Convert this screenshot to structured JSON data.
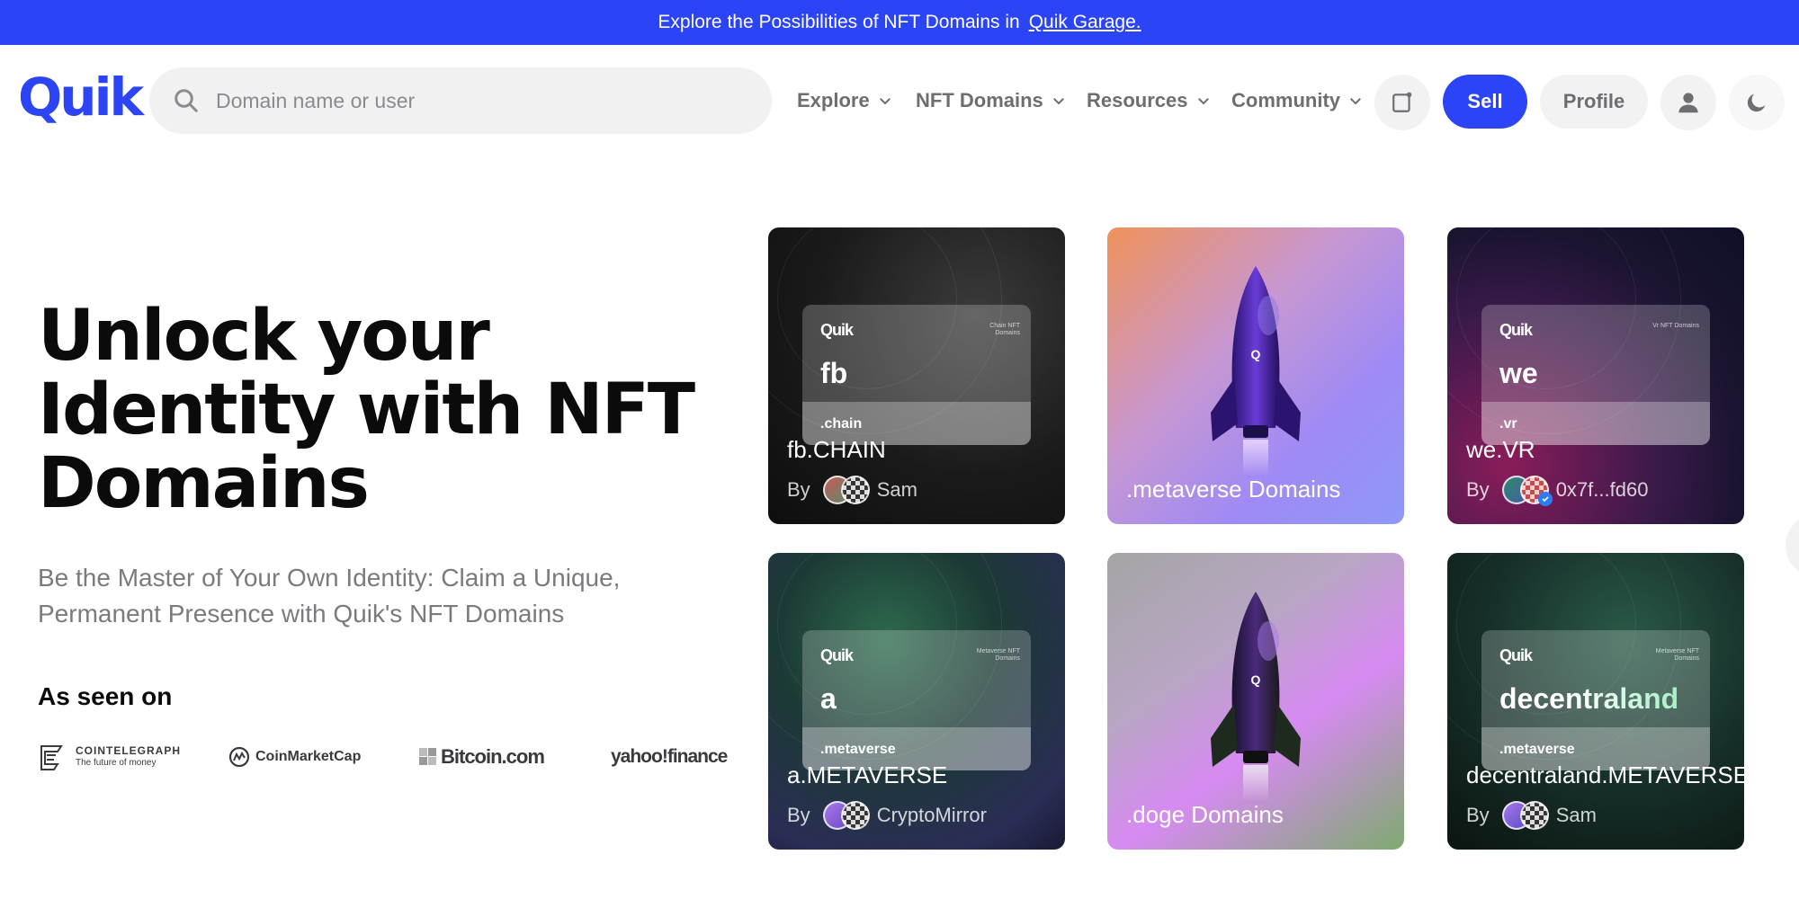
{
  "banner": {
    "text": "Explore the Possibilities of NFT Domains in",
    "link": "Quik Garage."
  },
  "header": {
    "logo": "Quik",
    "search_placeholder": "Domain name or user",
    "nav": [
      "Explore",
      "NFT Domains",
      "Resources",
      "Community"
    ],
    "sell_label": "Sell",
    "profile_label": "Profile",
    "icons": [
      "search-icon",
      "chevron-down-icon",
      "checklist-icon",
      "user-icon",
      "moon-icon"
    ]
  },
  "hero": {
    "title_lines": [
      "Unlock your",
      "Identity with NFT",
      "Domains"
    ],
    "subtitle": "Be the Master of Your Own Identity: Claim a Unique, Permanent Presence with Quik's NFT Domains",
    "seen_on": "As seen on",
    "press": {
      "cointelegraph_name": "COINTELEGRAPH",
      "cointelegraph_tag": "The future of money",
      "coinmarketcap": "CoinMarketCap",
      "bitcoin": "Bitcoin.com",
      "yahoo": "yahoo!finance"
    }
  },
  "cards": [
    {
      "type": "domain",
      "brand": "Quik",
      "category": "Chain NFT Domains",
      "name": "fb",
      "tld": ".chain",
      "title": "fb.CHAIN",
      "by": "By",
      "owner": "Sam"
    },
    {
      "type": "collection",
      "title": ".metaverse Domains"
    },
    {
      "type": "domain",
      "brand": "Quik",
      "category": "Vr NFT Domains",
      "name": "we",
      "tld": ".vr",
      "title": "we.VR",
      "by": "By",
      "owner": "0x7f...fd60"
    },
    {
      "type": "domain",
      "brand": "Quik",
      "category": "Metaverse NFT Domains",
      "name": "a",
      "tld": ".metaverse",
      "title": "a.METAVERSE",
      "by": "By",
      "owner": "CryptoMirror"
    },
    {
      "type": "collection",
      "title": ".doge Domains"
    },
    {
      "type": "domain",
      "brand": "Quik",
      "category": "Metaverse NFT Domains",
      "name": "decentraland",
      "tld": ".metaverse",
      "title": "decentraland.METAVERSE",
      "by": "By",
      "owner": "Sam"
    }
  ],
  "colors": {
    "accent": "#2b44f5"
  }
}
